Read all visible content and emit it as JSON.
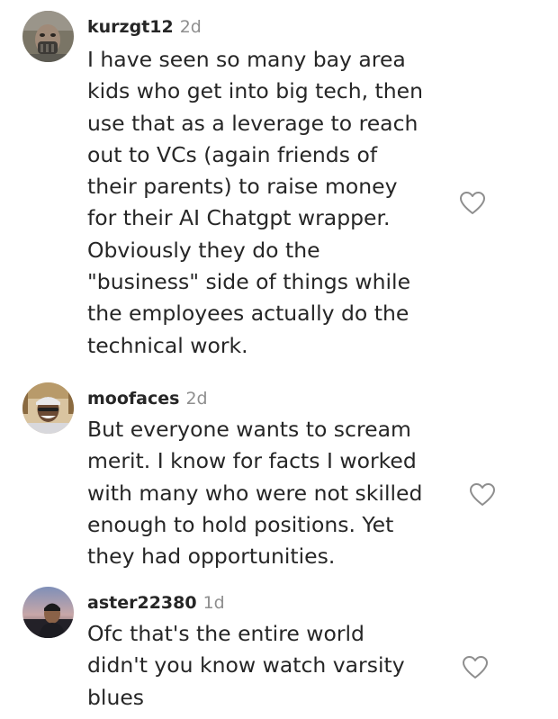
{
  "comments": [
    {
      "username": "kurzgt12",
      "time": "2d",
      "lines": [
        "I have seen so many bay area",
        "kids who get into big tech, then",
        "use that as a leverage to reach",
        "out to VCs (again friends of",
        "their parents) to raise money",
        "for their AI Chatgpt wrapper.",
        "Obviously they do the",
        "\"business\" side of things while",
        "the employees actually do the",
        "technical work."
      ],
      "like_icon": "heart-outline-icon"
    },
    {
      "username": "moofaces",
      "time": "2d",
      "lines": [
        "But everyone wants to scream",
        "merit. I know for facts I worked",
        "with many who were not skilled",
        "enough to hold positions. Yet",
        "they had opportunities."
      ],
      "like_icon": "heart-outline-icon"
    },
    {
      "username": "aster22380",
      "time": "1d",
      "lines": [
        "Ofc that's the entire world",
        "didn't you know watch varsity",
        "blues"
      ],
      "like_icon": "heart-outline-icon"
    }
  ],
  "colors": {
    "text": "#262626",
    "muted": "#8e8e8e",
    "background": "#ffffff"
  }
}
